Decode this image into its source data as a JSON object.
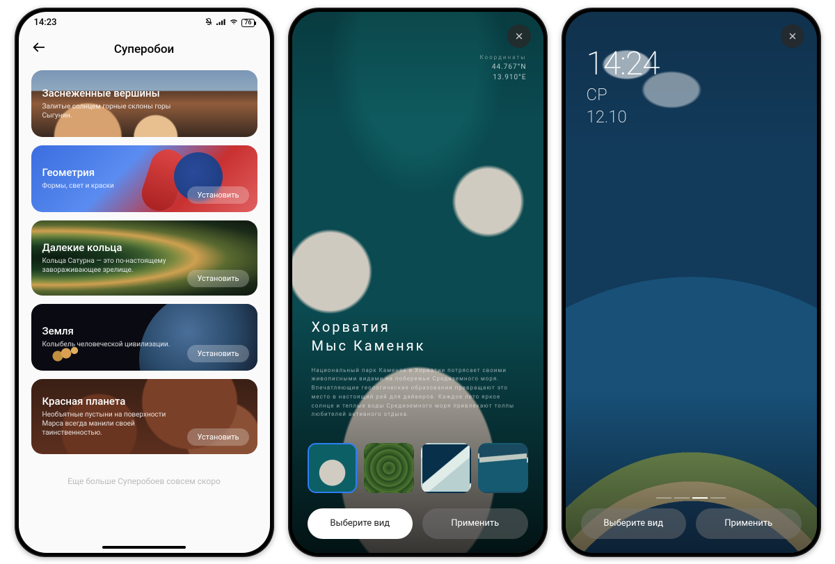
{
  "phone1": {
    "status": {
      "time": "14:23",
      "battery": "76"
    },
    "nav": {
      "title": "Суперобои",
      "back_icon": "back-arrow"
    },
    "cards": [
      {
        "title": "Заснеженные вершины",
        "sub": "Залитые солнцем горные склоны горы Сыгунян.",
        "install": null
      },
      {
        "title": "Геометрия",
        "sub": "Формы, свет и краски",
        "install": "Установить"
      },
      {
        "title": "Далекие кольца",
        "sub": "Кольца Сатурна — это по-настоящему завораживающее зрелище.",
        "install": "Установить"
      },
      {
        "title": "Земля",
        "sub": "Колыбель человеческой цивилизации.",
        "install": "Установить"
      },
      {
        "title": "Красная планета",
        "sub": "Необъятные пустыни на поверхности Марса всегда манили своей таинственностью.",
        "install": "Установить"
      }
    ],
    "footer": "Еще больше Суперобоев совсем скоро"
  },
  "phone2": {
    "close_icon": "close",
    "coords": {
      "label": "Координаты",
      "lat": "44.767°N",
      "lon": "13.910°E"
    },
    "location": {
      "line1": "Хорватия",
      "line2": "Мыс Каменяк"
    },
    "description": "Национальный парк Каменяк в Хорватии потрясает своими живописными видами на побережье Средиземного моря. Впечатляющие геологические образования превращают это место в настоящий рай для дайверов. Каждое лето яркое солнце и теплые воды Средиземного моря привлекают толпы любителей активного отдыха.",
    "thumbnails": [
      {
        "name": "rocks",
        "selected": true
      },
      {
        "name": "terraces",
        "selected": false
      },
      {
        "name": "iceberg",
        "selected": false
      },
      {
        "name": "coast",
        "selected": false
      }
    ],
    "buttons": {
      "left": "Выберите вид",
      "right": "Применить"
    }
  },
  "phone3": {
    "close_icon": "close",
    "lock": {
      "time": "14:24",
      "day": "СР",
      "date": "12.10"
    },
    "page_indicator": {
      "count": 4,
      "active": 2
    },
    "buttons": {
      "left": "Выберите вид",
      "right": "Применить"
    }
  }
}
